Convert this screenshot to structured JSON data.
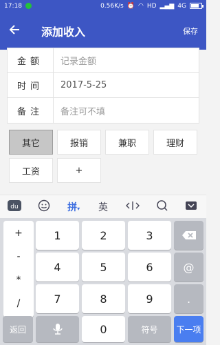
{
  "status": {
    "time": "17:18",
    "speed": "0.56K/s",
    "hd": "HD",
    "network": "4G"
  },
  "appbar": {
    "back_icon": "arrow-left-icon",
    "title": "添加收入",
    "save_label": "保存"
  },
  "form": {
    "rows": [
      {
        "label": "金额",
        "placeholder": "记录金额"
      },
      {
        "label": "时间",
        "value": "2017-5-25"
      },
      {
        "label": "备注",
        "placeholder": "备注可不填"
      }
    ]
  },
  "categories": [
    {
      "label": "其它",
      "selected": true
    },
    {
      "label": "报销",
      "selected": false
    },
    {
      "label": "兼职",
      "selected": false
    },
    {
      "label": "理财",
      "selected": false
    },
    {
      "label": "工资",
      "selected": false
    },
    {
      "label": "+",
      "selected": false
    }
  ],
  "keyboard": {
    "toolbar": {
      "logo": "du",
      "pinyin": "拼",
      "english": "英"
    },
    "symbols": [
      "+",
      "-",
      "*",
      "/"
    ],
    "digits": [
      "1",
      "2",
      "3",
      "4",
      "5",
      "6",
      "7",
      "8",
      "9",
      "0"
    ],
    "side_keys": [
      "@",
      "."
    ],
    "back_label": "返回",
    "symbol_label": "符号",
    "next_label": "下一项"
  }
}
